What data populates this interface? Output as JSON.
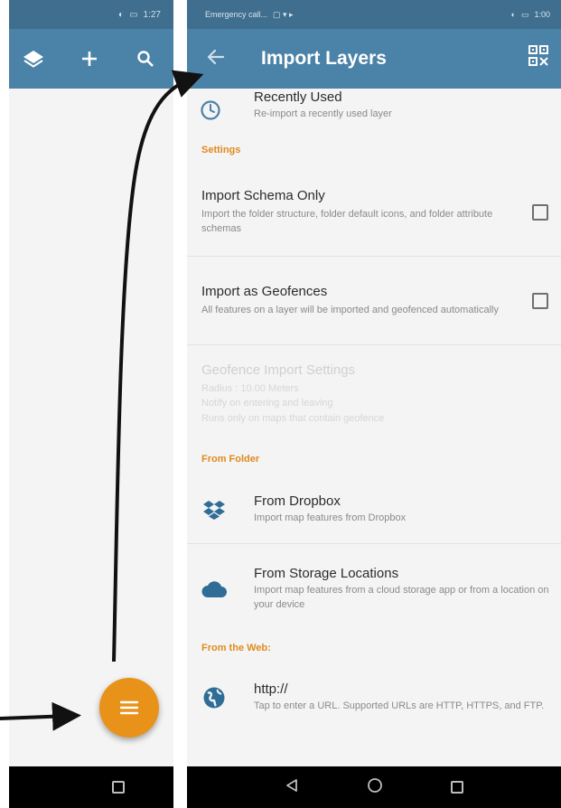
{
  "left_screen": {
    "status_time": "1:27",
    "toolbar_icons": [
      "layers-icon",
      "add-icon",
      "search-icon"
    ]
  },
  "right_screen": {
    "status_left": "Emergency call...",
    "status_time": "1:00",
    "title": "Import Layers",
    "recently_used": {
      "title": "Recently Used",
      "subtitle": "Re-import a recently used layer"
    },
    "settings_header": "Settings",
    "settings": [
      {
        "title": "Import Schema Only",
        "subtitle": "Import the folder structure, folder default icons, and folder attribute schemas",
        "checked": false
      },
      {
        "title": "Import as Geofences",
        "subtitle": "All features on a layer will be imported and geofenced automatically",
        "checked": false
      }
    ],
    "geofence_settings": {
      "title": "Geofence Import Settings",
      "lines": [
        "Radius : 10.00 Meters",
        "Notify on entering and leaving",
        "Runs only on maps that contain geofence"
      ]
    },
    "from_folder_header": "From Folder",
    "from_folder": [
      {
        "title": "From Dropbox",
        "subtitle": "Import map features from Dropbox",
        "icon": "dropbox-icon"
      },
      {
        "title": "From Storage Locations",
        "subtitle": "Import map features from a cloud storage app or from a location on your device",
        "icon": "cloud-icon"
      }
    ],
    "from_web_header": "From the Web:",
    "from_web": [
      {
        "title": "http://",
        "subtitle": "Tap to enter a URL. Supported URLs are HTTP, HTTPS, and FTP.",
        "icon": "globe-icon"
      }
    ]
  },
  "colors": {
    "app_bar": "#4b82a7",
    "status_bar": "#3f6e8e",
    "accent": "#e9921a",
    "section_header": "#e08a1c"
  }
}
